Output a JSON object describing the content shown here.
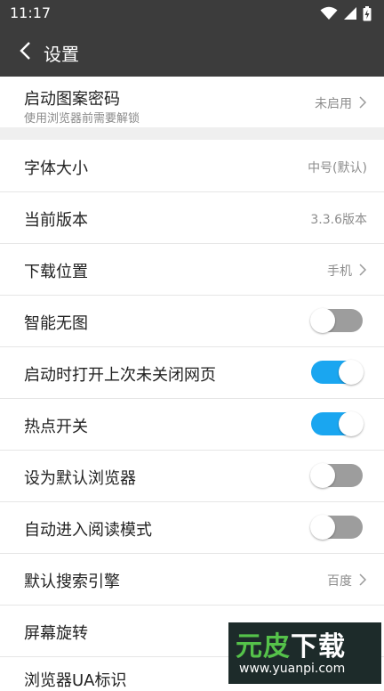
{
  "status_bar": {
    "time": "11:17"
  },
  "app_bar": {
    "title": "设置"
  },
  "settings": {
    "pattern_lock": {
      "label": "启动图案密码",
      "sub": "使用浏览器前需要解锁",
      "value": "未启用"
    },
    "font_size": {
      "label": "字体大小",
      "value": "中号(默认)"
    },
    "version": {
      "label": "当前版本",
      "value": "3.3.6版本"
    },
    "download_location": {
      "label": "下载位置",
      "value": "手机"
    },
    "smart_no_image": {
      "label": "智能无图",
      "state": "off"
    },
    "restore_tabs": {
      "label": "启动时打开上次未关闭网页",
      "state": "on"
    },
    "hotspot": {
      "label": "热点开关",
      "state": "on"
    },
    "default_browser": {
      "label": "设为默认浏览器",
      "state": "off"
    },
    "auto_reader": {
      "label": "自动进入阅读模式",
      "state": "off"
    },
    "search_engine": {
      "label": "默认搜索引擎",
      "value": "百度"
    },
    "screen_rotation": {
      "label": "屏幕旋转"
    },
    "ua": {
      "label": "浏览器UA标识"
    }
  },
  "colors": {
    "header": "#3c3c3c",
    "toggle_on": "#1aa6f0",
    "toggle_off": "#9d9d9d"
  },
  "watermark": {
    "text_green": "元皮",
    "text_white": "下载",
    "url": "www.yuanpi.com"
  }
}
